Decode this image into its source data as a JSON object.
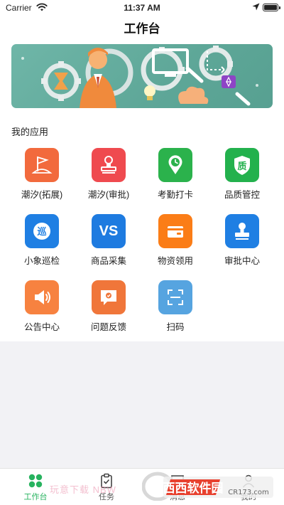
{
  "status_bar": {
    "carrier": "Carrier",
    "time": "11:37 AM"
  },
  "nav": {
    "title": "工作台"
  },
  "section": {
    "title": "我的应用"
  },
  "apps": [
    {
      "label": "潮汐(拓展)",
      "icon": "flag-icon",
      "color": "#f26a3d"
    },
    {
      "label": "潮汐(审批)",
      "icon": "stamp-icon",
      "color": "#ef4a4f"
    },
    {
      "label": "考勤打卡",
      "icon": "location-clock-icon",
      "color": "#2bb24c"
    },
    {
      "label": "品质管控",
      "icon": "quality-shield-icon",
      "color": "#23b14d"
    },
    {
      "label": "小象巡检",
      "icon": "patrol-icon",
      "color": "#1f7fe3"
    },
    {
      "label": "商品采集",
      "icon": "vs-icon",
      "color": "#1e7be0"
    },
    {
      "label": "物资领用",
      "icon": "wallet-icon",
      "color": "#fb7d17"
    },
    {
      "label": "审批中心",
      "icon": "approval-stamp-icon",
      "color": "#1f7fe3"
    },
    {
      "label": "公告中心",
      "icon": "megaphone-icon",
      "color": "#f78240"
    },
    {
      "label": "问题反馈",
      "icon": "feedback-icon",
      "color": "#f0763a"
    },
    {
      "label": "扫码",
      "icon": "scan-icon",
      "color": "#56a4e0"
    }
  ],
  "icon_text": {
    "quality": "质",
    "patrol": "巡",
    "vs": "VS"
  },
  "tabs": [
    {
      "label": "工作台",
      "icon": "grid-icon",
      "active": true
    },
    {
      "label": "任务",
      "icon": "clipboard-icon",
      "active": false
    },
    {
      "label": "消息",
      "icon": "message-icon",
      "active": false
    },
    {
      "label": "我的",
      "icon": "user-icon",
      "active": false
    }
  ],
  "watermark": {
    "left_text": "玩意下载 NBW",
    "logo_text": "西西软件园",
    "logo_sub": "CR173.com"
  },
  "colors": {
    "accent": "#27b35f",
    "banner": "#63ab9c"
  }
}
